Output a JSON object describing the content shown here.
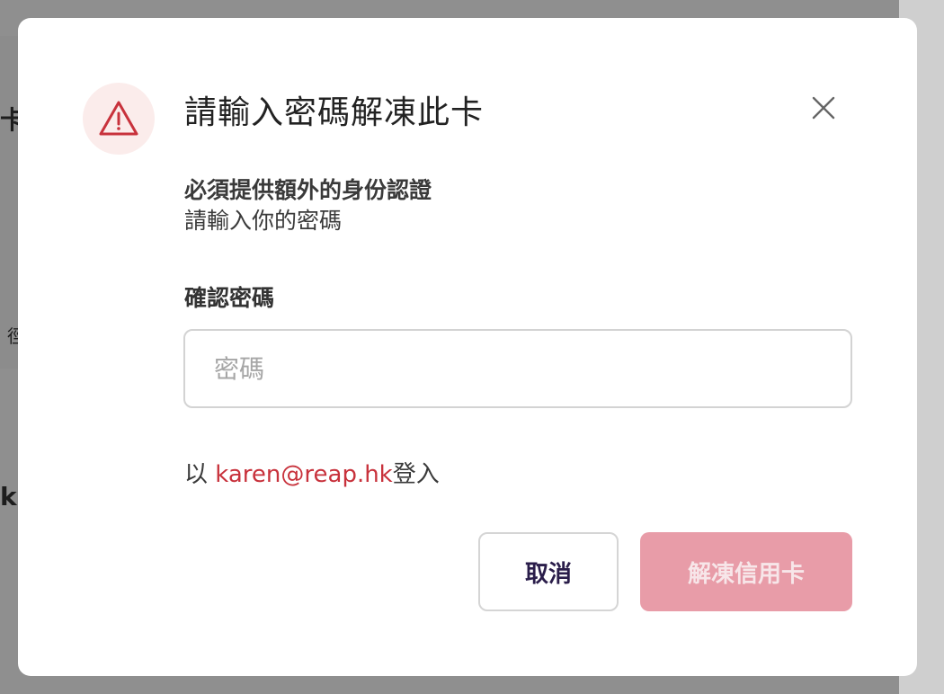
{
  "background": {
    "fragment_1": "卡",
    "fragment_2": "k's",
    "fragment_3": "徑"
  },
  "dialog": {
    "title": "請輸入密碼解凍此卡",
    "icon": "warning-triangle-icon",
    "close_icon": "close-icon",
    "subtitle_bold": "必須提供額外的身份認證",
    "subtitle": "請輸入你的密碼",
    "field_label": "確認密碼",
    "password_placeholder": "密碼",
    "password_value": "",
    "login_prefix": "以 ",
    "login_email": "karen@reap.hk",
    "login_suffix": "登入",
    "cancel_label": "取消",
    "unfreeze_label": "解凍信用卡"
  },
  "colors": {
    "accent_red": "#c8323c",
    "warning_bg": "#fbeceb",
    "disabled_button": "#e89ca8"
  }
}
